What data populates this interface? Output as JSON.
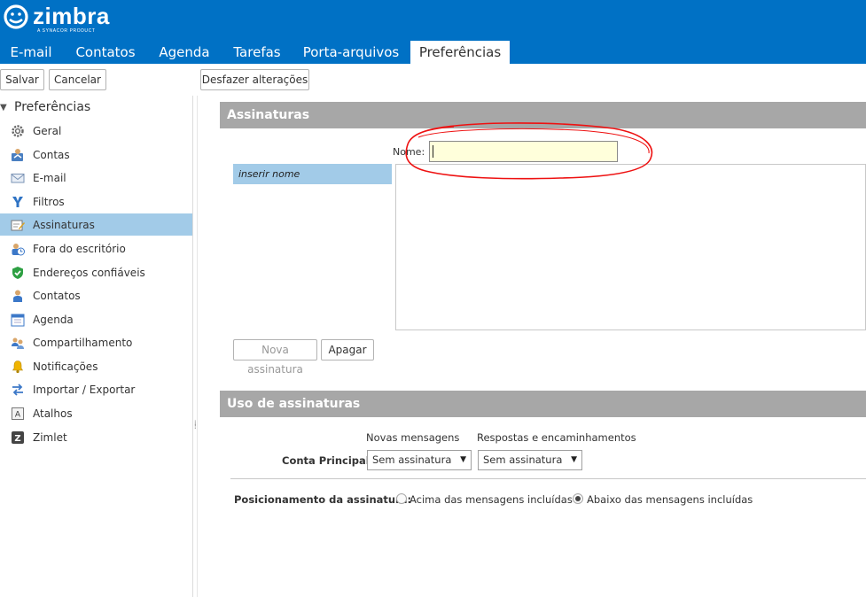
{
  "brand": {
    "name": "zimbra",
    "tagline": "A SYNACOR PRODUCT",
    "color": "#0071c5"
  },
  "tabs": [
    {
      "label": "E-mail"
    },
    {
      "label": "Contatos"
    },
    {
      "label": "Agenda"
    },
    {
      "label": "Tarefas"
    },
    {
      "label": "Porta-arquivos"
    },
    {
      "label": "Preferências",
      "active": true
    }
  ],
  "toolbar": {
    "save_label": "Salvar",
    "cancel_label": "Cancelar",
    "undo_label": "Desfazer alterações"
  },
  "sidebar": {
    "header": "Preferências",
    "items": [
      {
        "label": "Geral",
        "icon": "gear-icon"
      },
      {
        "label": "Contas",
        "icon": "accounts-icon"
      },
      {
        "label": "E-mail",
        "icon": "envelope-icon"
      },
      {
        "label": "Filtros",
        "icon": "filter-icon"
      },
      {
        "label": "Assinaturas",
        "icon": "signature-icon",
        "selected": true
      },
      {
        "label": "Fora do escritório",
        "icon": "out-of-office-icon"
      },
      {
        "label": "Endereços confiáveis",
        "icon": "shield-check-icon"
      },
      {
        "label": "Contatos",
        "icon": "contact-icon"
      },
      {
        "label": "Agenda",
        "icon": "calendar-icon"
      },
      {
        "label": "Compartilhamento",
        "icon": "sharing-icon"
      },
      {
        "label": "Notificações",
        "icon": "bell-icon"
      },
      {
        "label": "Importar / Exportar",
        "icon": "import-export-icon"
      },
      {
        "label": "Atalhos",
        "icon": "keyboard-shortcut-icon"
      },
      {
        "label": "Zimlet",
        "icon": "zimlet-icon"
      }
    ],
    "selected_color": "#a2cbe8"
  },
  "signatures": {
    "section_title": "Assinaturas",
    "name_label": "Nome:",
    "name_value": "",
    "list": [
      {
        "label": "inserir nome"
      }
    ],
    "new_button": "Nova assinatura",
    "delete_button": "Apagar"
  },
  "usage": {
    "section_title": "Uso de assinaturas",
    "col_new": "Novas mensagens",
    "col_replies": "Respostas e encaminhamentos",
    "account_label": "Conta Principal:",
    "new_select": "Sem assinatura",
    "replies_select": "Sem assinatura",
    "position_label": "Posicionamento da assinatura:",
    "position_options": [
      {
        "label": "Acima das mensagens incluídas",
        "checked": false
      },
      {
        "label": "Abaixo das mensagens incluídas",
        "checked": true
      }
    ]
  }
}
